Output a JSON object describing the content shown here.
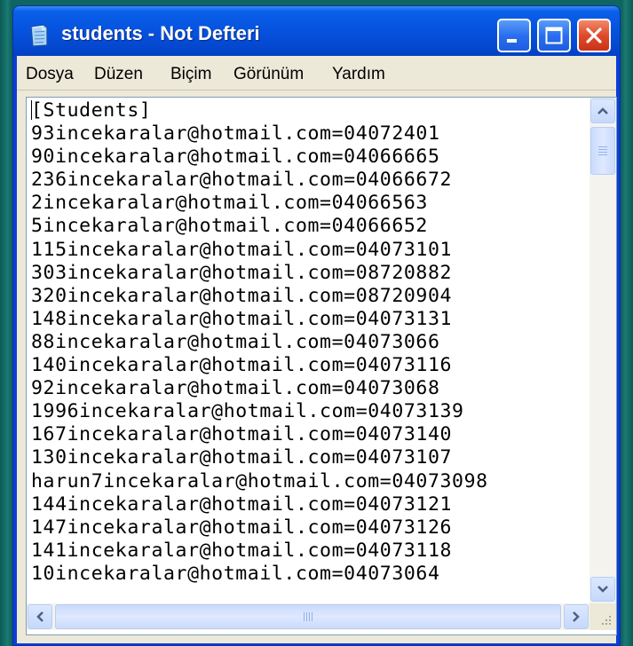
{
  "window": {
    "title": "students - Not Defteri"
  },
  "menu": [
    {
      "label": "Dosya"
    },
    {
      "label": "Düzen"
    },
    {
      "label": "Biçim"
    },
    {
      "label": "Görünüm"
    },
    {
      "label": "Yardım"
    }
  ],
  "document": {
    "lines": [
      "[Students]",
      "93incekaralar@hotmail.com=04072401",
      "90incekaralar@hotmail.com=04066665",
      "236incekaralar@hotmail.com=04066672",
      "2incekaralar@hotmail.com=04066563",
      "5incekaralar@hotmail.com=04066652",
      "115incekaralar@hotmail.com=04073101",
      "303incekaralar@hotmail.com=08720882",
      "320incekaralar@hotmail.com=08720904",
      "148incekaralar@hotmail.com=04073131",
      "88incekaralar@hotmail.com=04073066",
      "140incekaralar@hotmail.com=04073116",
      "92incekaralar@hotmail.com=04073068",
      "1996incekaralar@hotmail.com=04073139",
      "167incekaralar@hotmail.com=04073140",
      "130incekaralar@hotmail.com=04073107",
      "harun7incekaralar@hotmail.com=04073098",
      "144incekaralar@hotmail.com=04073121",
      "147incekaralar@hotmail.com=04073126",
      "141incekaralar@hotmail.com=04073118",
      "10incekaralar@hotmail.com=04073064"
    ]
  },
  "colors": {
    "titlebar": "#0654e0",
    "desktop": "#0f6660",
    "close_button": "#e04a2a"
  },
  "icons": [
    "notepad-icon",
    "minimize-icon",
    "maximize-icon",
    "close-icon",
    "arrow-up-icon",
    "arrow-down-icon",
    "arrow-left-icon",
    "arrow-right-icon",
    "size-grip-icon"
  ]
}
